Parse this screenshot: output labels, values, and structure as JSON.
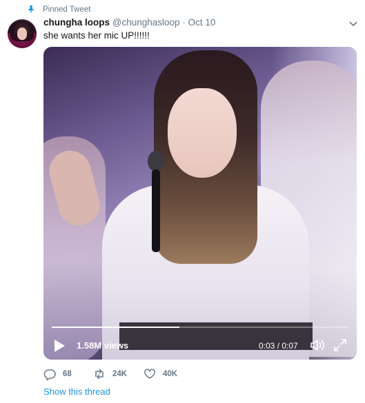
{
  "pinned": {
    "label": "Pinned Tweet"
  },
  "tweet": {
    "display_name": "chungha loops",
    "handle": "@chunghasloop",
    "separator": "·",
    "date": "Oct 10",
    "text": "she wants her mic UP!!!!!!"
  },
  "video": {
    "views": "1.58M views",
    "time": "0:03 / 0:07",
    "progress": 0.43
  },
  "actions": {
    "replies": "68",
    "retweets": "24K",
    "likes": "40K"
  },
  "thread_link": "Show this thread",
  "colors": {
    "accent": "#1b95e0",
    "muted": "#657786",
    "text": "#14171a"
  }
}
